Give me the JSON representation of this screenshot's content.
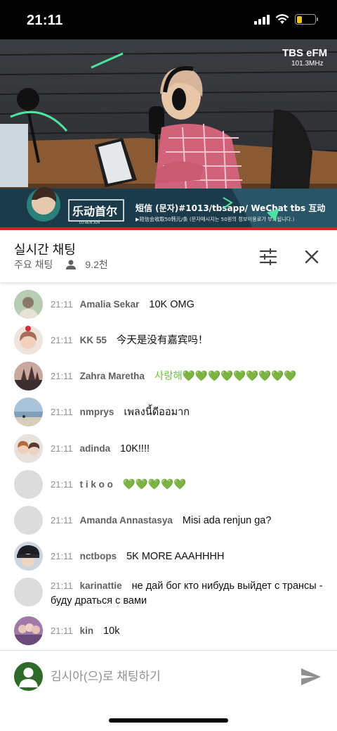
{
  "status_bar": {
    "time": "21:11",
    "battery_level": 0.3,
    "battery_color": "#f3c318"
  },
  "video": {
    "station_logo": "TBS eFM",
    "frequency": "101.3MHz",
    "banner_logo": "乐动首尔",
    "banner_dj": "DJ REN JUN",
    "banner_line1": "短信 (문자)#1013/tbsapp/ WeChat tbs 互动",
    "banner_line2": "▶短信会收取50韩元/条 (문자메시지는 50원의 정보이용료가 부과됩니다.)",
    "progress": 1.0,
    "progress_color": "#e51c23"
  },
  "chat_header": {
    "title": "실시간 채팅",
    "mode": "주요 채팅",
    "viewers": "9.2천",
    "icons": {
      "viewers": "person-icon",
      "filter": "sliders-icon",
      "close": "close-icon"
    }
  },
  "messages": [
    {
      "time": "21:11",
      "author": "Amalia Sekar",
      "text": "10K OMG"
    },
    {
      "time": "21:11",
      "author": "KK 55",
      "text": "今天是没有嘉宾吗！"
    },
    {
      "time": "21:11",
      "author": "Zahra Maretha",
      "text": "사랑해💚💚💚💚💚💚💚💚💚"
    },
    {
      "time": "21:11",
      "author": "nmprys",
      "text": "เพลงนี้ดีออมาก"
    },
    {
      "time": "21:11",
      "author": "adinda",
      "text": "10K!!!!"
    },
    {
      "time": "21:11",
      "author": "t i k o o",
      "text": "💚💚💚💚💚"
    },
    {
      "time": "21:11",
      "author": "Amanda Annastasya",
      "text": "Misi ada renjun ga?"
    },
    {
      "time": "21:11",
      "author": "nctbops",
      "text": "5K MORE AAAHHHH"
    },
    {
      "time": "21:11",
      "author": "karinattie",
      "text": "не дай бог кто нибудь выйдет с трансы - буду драться с вами"
    },
    {
      "time": "21:11",
      "author": "kin",
      "text": "10k"
    }
  ],
  "input": {
    "placeholder": "김시아(으)로 채팅하기",
    "value": "",
    "send_icon": "send-icon"
  }
}
